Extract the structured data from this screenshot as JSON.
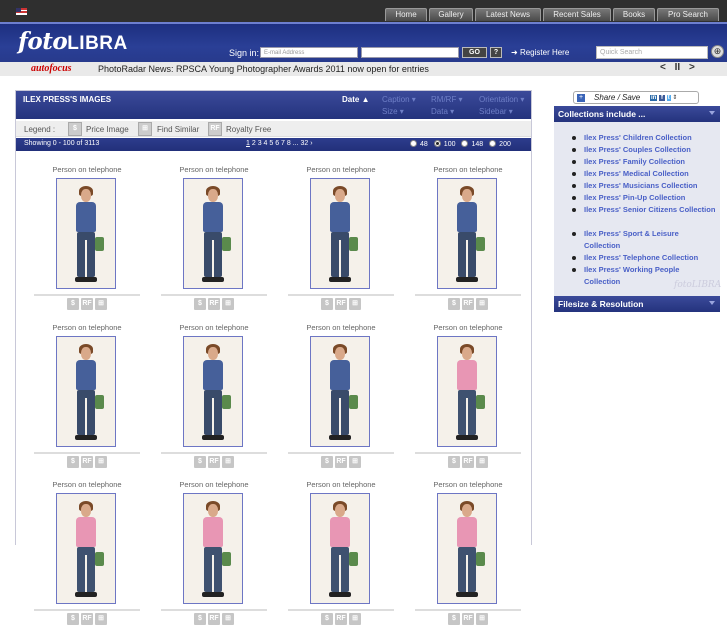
{
  "topnav": [
    "Home",
    "Gallery",
    "Latest News",
    "Recent Sales",
    "Books",
    "Pro Search"
  ],
  "header": {
    "logo_main": "foto",
    "logo_sub": "LIBRA",
    "signin_label": "Sign in:",
    "email_placeholder": "E-mail Address",
    "go_label": "GO",
    "help_label": "?",
    "register_label": "Register Here",
    "quick_search_placeholder": "Quick Search"
  },
  "news": {
    "brand": "autofocus",
    "text": "PhotoRadar News: RPSCA Young Photographer Awards 2011 now open for entries",
    "nav": "< II >"
  },
  "results": {
    "title": "ILEX PRESS'S IMAGES",
    "sort": {
      "date": "Date",
      "caption": "Caption",
      "rmrf": "RM/RF",
      "orientation": "Orientation",
      "size": "Size",
      "data": "Data",
      "sidebar": "Sidebar"
    },
    "legend": {
      "label": "Legend :",
      "price": "Price Image",
      "similar": "Find Similar",
      "royalty": "Royalty Free"
    },
    "showing": "Showing 0 - 100 of 3113",
    "pages_current": "1",
    "pages_rest": " 2 3 4 5 6 7 8 ... 32 ›",
    "per_page": [
      "48",
      "100",
      "148",
      "200"
    ],
    "per_page_selected": "100"
  },
  "grid": [
    {
      "caption": "Person on telephone",
      "variant": "blue"
    },
    {
      "caption": "Person on telephone",
      "variant": "blue"
    },
    {
      "caption": "Person on telephone",
      "variant": "blue"
    },
    {
      "caption": "Person on telephone",
      "variant": "blue"
    },
    {
      "caption": "Person on telephone",
      "variant": "blue"
    },
    {
      "caption": "Person on telephone",
      "variant": "blue"
    },
    {
      "caption": "Person on telephone",
      "variant": "blue"
    },
    {
      "caption": "Person on telephone",
      "variant": "pink"
    },
    {
      "caption": "Person on telephone",
      "variant": "pink"
    },
    {
      "caption": "Person on telephone",
      "variant": "pink"
    },
    {
      "caption": "Person on telephone",
      "variant": "pink"
    },
    {
      "caption": "Person on telephone",
      "variant": "pink"
    }
  ],
  "cell_icons": [
    "$",
    "RF",
    "⊞"
  ],
  "sidebar": {
    "share_label": "Share / Save",
    "collections_title": "Collections include ...",
    "collections": [
      "Ilex Press' Children Collection",
      "Ilex Press' Couples Collection",
      "Ilex Press' Family Collection",
      "Ilex Press' Medical Collection",
      "Ilex Press' Musicians Collection",
      "Ilex Press' Pin-Up Collection",
      "Ilex Press' Senior Citizens Collection",
      "Ilex Press' Sport & Leisure Collection",
      "Ilex Press' Telephone Collection",
      "Ilex Press' Working People Collection"
    ],
    "watermark": "fotoLIBRA",
    "filesize_title": "Filesize & Resolution"
  },
  "colors": {
    "brand_blue": "#24337d",
    "link_blue": "#4a60c7",
    "autofocus_red": "#cc0000"
  }
}
